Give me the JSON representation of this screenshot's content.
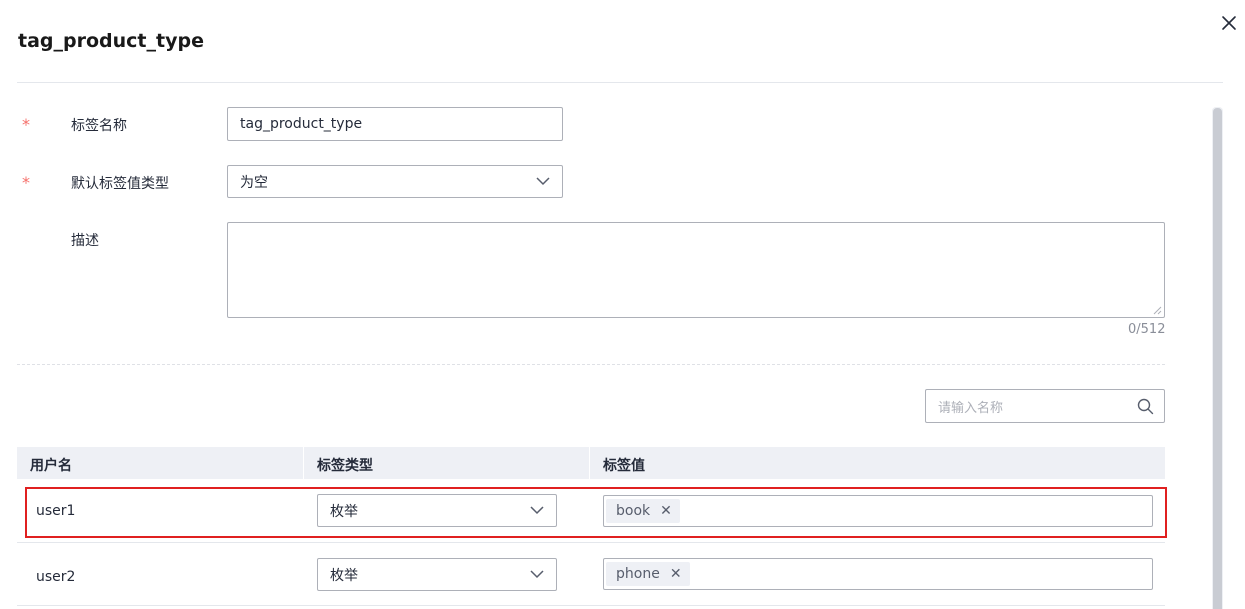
{
  "dialog": {
    "title": "tag_product_type",
    "close_icon": "close-icon"
  },
  "form": {
    "required_mark": "*",
    "tag_name": {
      "label": "标签名称",
      "value": "tag_product_type"
    },
    "default_value_type": {
      "label": "默认标签值类型",
      "value": "为空"
    },
    "description": {
      "label": "描述",
      "value": "",
      "counter": "0/512"
    }
  },
  "search": {
    "placeholder": "请输入名称",
    "icon": "search-icon"
  },
  "table": {
    "columns": [
      "用户名",
      "标签类型",
      "标签值"
    ],
    "rows": [
      {
        "user": "user1",
        "tag_type": "枚举",
        "tag_values": [
          "book"
        ],
        "highlighted": true
      },
      {
        "user": "user2",
        "tag_type": "枚举",
        "tag_values": [
          "phone"
        ],
        "highlighted": false
      }
    ]
  },
  "colors": {
    "highlight": "#e02020",
    "required": "#f66f6a",
    "header_bg": "#eef0f5"
  }
}
